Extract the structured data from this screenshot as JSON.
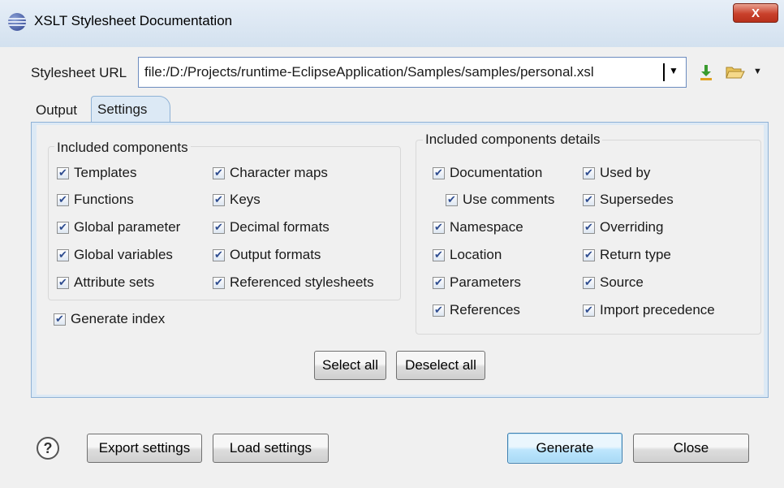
{
  "window": {
    "title": "XSLT Stylesheet Documentation",
    "close_label": "X"
  },
  "url": {
    "label": "Stylesheet URL",
    "value": "file:/D:/Projects/runtime-EclipseApplication/Samples/samples/personal.xsl"
  },
  "tabs": [
    {
      "label": "Output",
      "selected": false
    },
    {
      "label": "Settings",
      "selected": true
    }
  ],
  "components": {
    "title": "Included components",
    "items": [
      {
        "label": "Templates",
        "checked": true
      },
      {
        "label": "Functions",
        "checked": true
      },
      {
        "label": "Global parameter",
        "checked": true
      },
      {
        "label": "Global variables",
        "checked": true
      },
      {
        "label": "Attribute sets",
        "checked": true
      },
      {
        "label": "Character maps",
        "checked": true
      },
      {
        "label": "Keys",
        "checked": true
      },
      {
        "label": "Decimal formats",
        "checked": true
      },
      {
        "label": "Output formats",
        "checked": true
      },
      {
        "label": "Referenced stylesheets",
        "checked": true
      }
    ]
  },
  "generate_index": {
    "label": "Generate index",
    "checked": true
  },
  "details": {
    "title": "Included components details",
    "items": [
      {
        "label": "Documentation",
        "checked": true
      },
      {
        "label": "Use comments",
        "checked": true
      },
      {
        "label": "Namespace",
        "checked": true
      },
      {
        "label": "Location",
        "checked": true
      },
      {
        "label": "Parameters",
        "checked": true
      },
      {
        "label": "References",
        "checked": true
      },
      {
        "label": "Used by",
        "checked": true
      },
      {
        "label": "Supersedes",
        "checked": true
      },
      {
        "label": "Overriding",
        "checked": true
      },
      {
        "label": "Return type",
        "checked": true
      },
      {
        "label": "Source",
        "checked": true
      },
      {
        "label": "Import precedence",
        "checked": true
      }
    ]
  },
  "buttons": {
    "select_all": "Select all",
    "deselect_all": "Deselect all",
    "export_settings": "Export settings",
    "load_settings": "Load settings",
    "generate": "Generate",
    "close": "Close"
  },
  "icons": {
    "app": "eclipse-icon",
    "download": "download-arrow-icon",
    "folder": "open-folder-icon",
    "help": "help-icon"
  },
  "colors": {
    "accent": "#3c7fb1",
    "tab_panel": "#dce9f5",
    "check": "#2e4c8f"
  }
}
